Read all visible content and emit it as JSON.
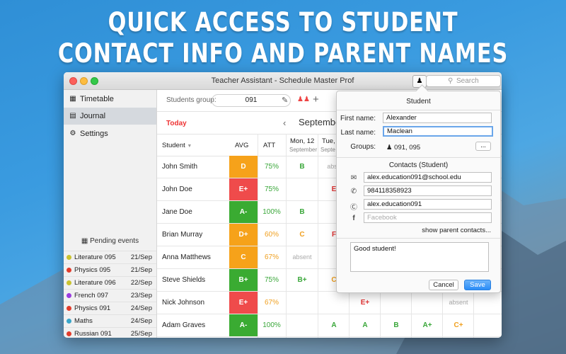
{
  "headline": {
    "line1": "QUICK ACCESS TO STUDENT",
    "line2": "CONTACT INFO AND PARENT NAMES"
  },
  "window": {
    "title": "Teacher Assistant - Schedule Master Prof",
    "search_placeholder": "Search"
  },
  "sidebar": {
    "items": [
      {
        "label": "Timetable",
        "icon": "calendar-icon"
      },
      {
        "label": "Journal",
        "icon": "journal-icon",
        "selected": true
      },
      {
        "label": "Settings",
        "icon": "gear-icon"
      }
    ],
    "pending_title": "Pending events",
    "pending": [
      {
        "name": "Literature 095",
        "date": "21/Sep",
        "color": "#c9c330"
      },
      {
        "name": "Physics 095",
        "date": "21/Sep",
        "color": "#e23c2c"
      },
      {
        "name": "Literature 096",
        "date": "22/Sep",
        "color": "#c9c330"
      },
      {
        "name": "French 097",
        "date": "23/Sep",
        "color": "#9a3ce0"
      },
      {
        "name": "Physics 091",
        "date": "24/Sep",
        "color": "#e23c2c"
      },
      {
        "name": "Maths",
        "date": "24/Sep",
        "color": "#3aa6c9"
      },
      {
        "name": "Russian 091",
        "date": "25/Sep",
        "color": "#e23c2c"
      }
    ]
  },
  "toolbar": {
    "group_label": "Students group:",
    "group_value": "091"
  },
  "datebar": {
    "today": "Today",
    "prev": "‹",
    "month": "September"
  },
  "table": {
    "headers": {
      "student": "Student",
      "avg": "AVG",
      "att": "ATT",
      "d1_day": "Mon, 12",
      "d1_month": "September",
      "d2_day": "Tue, 1",
      "d2_month": "Septe"
    },
    "rows": [
      {
        "name": "John Smith",
        "avg": "D",
        "avg_color": "#f6a21a",
        "att": "75%",
        "att_color": "#3aa73a",
        "d1": "B",
        "d1c": "#3aa73a",
        "d2": "abse",
        "d2c": "#aaaaaa",
        "d3": "",
        "d4": "",
        "d5": "",
        "d6": ""
      },
      {
        "name": "John Doe",
        "avg": "E+",
        "avg_color": "#ef4b4b",
        "att": "75%",
        "att_color": "#3aa73a",
        "d1": "",
        "d1c": "#3aa73a",
        "d2": "E",
        "d2c": "#e33333",
        "d3": "",
        "d4": "",
        "d5": "",
        "d6": ""
      },
      {
        "name": "Jane Doe",
        "avg": "A-",
        "avg_color": "#3aab32",
        "att": "100%",
        "att_color": "#3aa73a",
        "d1": "B",
        "d1c": "#3aa73a",
        "d2": "",
        "d2c": "#3aa73a",
        "d3": "",
        "d4": "",
        "d5": "",
        "d6": ""
      },
      {
        "name": "Brian Murray",
        "avg": "D+",
        "avg_color": "#f6a21a",
        "att": "60%",
        "att_color": "#f0a020",
        "d1": "C",
        "d1c": "#f0a020",
        "d2": "F",
        "d2c": "#e33333",
        "d3": "",
        "d4": "",
        "d5": "",
        "d6": ""
      },
      {
        "name": "Anna Matthews",
        "avg": "C",
        "avg_color": "#f6a21a",
        "att": "67%",
        "att_color": "#f0a020",
        "d1": "absent",
        "d1c": "#aaaaaa",
        "d2": "",
        "d2c": "#3aa73a",
        "d3": "",
        "d4": "",
        "d5": "",
        "d6": ""
      },
      {
        "name": "Steve Shields",
        "avg": "B+",
        "avg_color": "#3aab32",
        "att": "75%",
        "att_color": "#3aa73a",
        "d1": "B+",
        "d1c": "#3aa73a",
        "d2": "C",
        "d2c": "#f0a020",
        "d3": "",
        "d4": "",
        "d5": "",
        "d6": ""
      },
      {
        "name": "Nick Johnson",
        "avg": "E+",
        "avg_color": "#ef4b4b",
        "att": "67%",
        "att_color": "#f0a020",
        "d1": "",
        "d1c": "#3aa73a",
        "d2": "",
        "d2c": "#3aa73a",
        "d3": "E+",
        "d3c": "#e33333",
        "d4": "",
        "d5": "",
        "d6": "absent",
        "d6c": "#aaaaaa"
      },
      {
        "name": "Adam Graves",
        "avg": "A-",
        "avg_color": "#3aab32",
        "att": "100%",
        "att_color": "#3aa73a",
        "d1": "",
        "d1c": "#3aa73a",
        "d2": "A",
        "d2c": "#3aa73a",
        "d3": "A",
        "d3c": "#3aa73a",
        "d4": "B",
        "d4c": "#3aa73a",
        "d5": "A+",
        "d5c": "#3aa73a",
        "d6": "C+",
        "d6c": "#f0a020"
      }
    ]
  },
  "popover": {
    "title": "Student",
    "first_name_label": "First name:",
    "first_name": "Alexander",
    "last_name_label": "Last name:",
    "last_name": "Maclean",
    "groups_label": "Groups:",
    "groups": "091,  095",
    "more_button": "...",
    "contacts_title": "Contacts (Student)",
    "email": "alex.education091@school.edu",
    "phone": "984118358923",
    "skype": "alex.education091",
    "facebook_placeholder": "Facebook",
    "show_parent": "show parent contacts...",
    "note": "Good student!",
    "cancel": "Cancel",
    "save": "Save"
  }
}
